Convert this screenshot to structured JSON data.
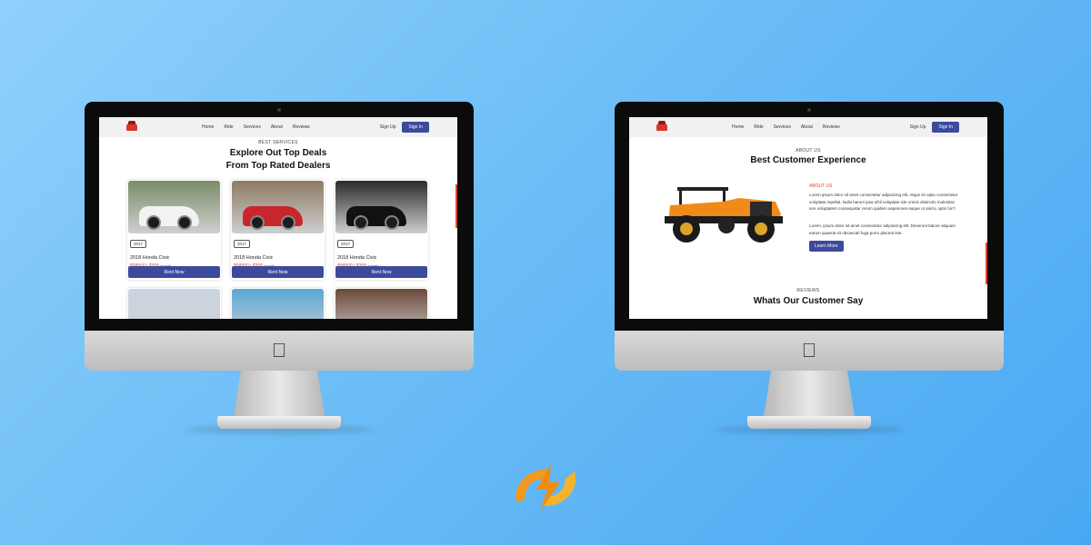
{
  "left_screen": {
    "nav": {
      "links": [
        "Home",
        "Ride",
        "Services",
        "About",
        "Reviews"
      ],
      "signup": "Sign Up",
      "signin": "Sign In"
    },
    "eyebrow": "BEST SERVICES",
    "heading_line1": "Explore Out Top Deals",
    "heading_line2": "From Top Rated Dealers",
    "cards": [
      {
        "year": "2017",
        "name": "2018 Honda Civic",
        "price": "$58500 | $358",
        "unit": "/month",
        "button": "Rent Now",
        "color": "#f2f2f2",
        "bg": "#7a8d6a"
      },
      {
        "year": "2017",
        "name": "2018 Honda Civic",
        "price": "$58500 | $358",
        "unit": "/month",
        "button": "Rent Now",
        "color": "#c9252c",
        "bg": "#8c7b63"
      },
      {
        "year": "2017",
        "name": "2018 Honda Civic",
        "price": "$58500 | $358",
        "unit": "/month",
        "button": "Rent Now",
        "color": "#111111",
        "bg": "#2a2a2a"
      },
      {
        "color": "#2c3a55",
        "bg": "#c9d6e3"
      },
      {
        "color": "#f2d21a",
        "bg": "#5aa8d6"
      },
      {
        "color": "#e07a1f",
        "bg": "#6b4a3a"
      }
    ]
  },
  "right_screen": {
    "nav": {
      "links": [
        "Home",
        "Ride",
        "Services",
        "About",
        "Reviews"
      ],
      "signup": "Sign Up",
      "signin": "Sign In"
    },
    "eyebrow": "ABOUT US",
    "heading": "Best Customer Experience",
    "about_label": "ABOUT US",
    "para1": "Lorem ipsum dolor sit amet consectetur adipisicing elit. Atque sit optio consectetur voluptate repellat. Nulla harum ipsa nihil voluptate iste omnis distinctio molestias iure voluptatem consequatur rerum quidem asperiores eaque ut animi, optio hic?",
    "para2": "Lorem, ipsum dolor sit amet consectetur adipisicing elit. Deserunt labore aliquam earum quaerat sit obcaecati fuga porro placeat iste.",
    "learn_button": "Learn More",
    "reviews_eyebrow": "REVIEWS",
    "reviews_heading": "Whats Our Customer Say"
  },
  "colors": {
    "accent": "#3d4a9c",
    "price": "#e0472b",
    "brand_orange": "#f39a1e"
  }
}
